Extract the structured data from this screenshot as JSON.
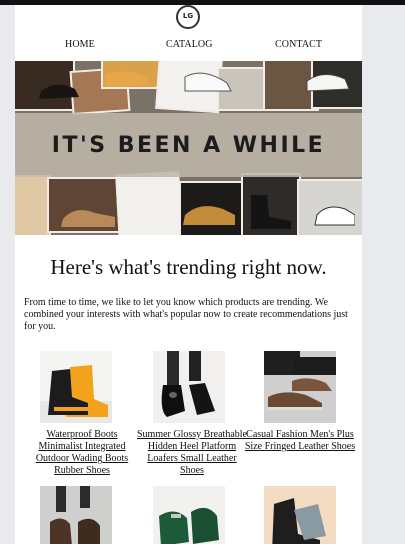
{
  "logo": {
    "text": "LG"
  },
  "nav": {
    "home": "HOME",
    "catalog": "CATALOG",
    "contact": "CONTACT"
  },
  "hero": {
    "banner_text": "IT'S BEEN A WHILE"
  },
  "headline": "Here's what's trending right now.",
  "intro": "From time to time, we like to let you know which products are trending. We combined your interests with what's popular now to create recommendations just for you.",
  "products": [
    {
      "name": "Waterproof Boots Minimalist Integrated Outdoor Wading Boots Rubber Shoes",
      "icon": "rubber-boot-image"
    },
    {
      "name": "Summer Glossy Breathable Hidden Heel Platform Loafers Small Leather Shoes",
      "icon": "black-loafer-image"
    },
    {
      "name": "Casual Fashion Men's Plus Size Fringed Leather Shoes",
      "icon": "brown-loafer-image"
    },
    {
      "name": "",
      "icon": "brown-tassel-shoe-image"
    },
    {
      "name": "",
      "icon": "green-loafer-image"
    },
    {
      "name": "",
      "icon": "high-top-sneaker-image"
    }
  ],
  "colors": {
    "boot_accent": "#f3a31b",
    "loafer_green": "#1d5a3a",
    "banner_band": "#bdb6aa"
  }
}
